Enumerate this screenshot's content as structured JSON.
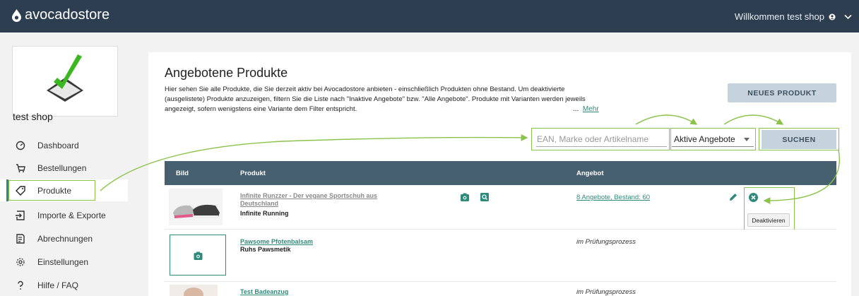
{
  "header": {
    "logo_text": "avocadostore",
    "welcome": "Willkommen test shop"
  },
  "sidebar": {
    "shop_name": "test shop",
    "items": [
      {
        "label": "Dashboard",
        "icon": "dashboard-icon"
      },
      {
        "label": "Bestellungen",
        "icon": "cart-icon"
      },
      {
        "label": "Produkte",
        "icon": "tag-icon",
        "active": true
      },
      {
        "label": "Importe & Exporte",
        "icon": "import-icon"
      },
      {
        "label": "Abrechnungen",
        "icon": "invoice-icon"
      },
      {
        "label": "Einstellungen",
        "icon": "gear-icon"
      },
      {
        "label": "Hilfe / FAQ",
        "icon": "help-icon"
      }
    ]
  },
  "main": {
    "title": "Angebotene Produkte",
    "description": "Hier sehen Sie alle Produkte, die Sie derzeit aktiv bei Avocadostore anbieten - einschließlich Produkten ohne Bestand. Um deaktivierte (ausgelistete) Produkte anzuzeigen, filtern Sie die Liste nach \"Inaktive Angebote\" bzw. \"Alle Angebote\". Produkte mit Varianten werden jeweils angezeigt, sofern wenigstens eine Variante dem Filter entspricht.",
    "more_ellipsis": "...",
    "more_link": "Mehr",
    "new_product_button": "NEUES PRODUKT",
    "search_placeholder": "EAN, Marke oder Artikelname",
    "filter_selected": "Aktive Angebote",
    "search_button": "SUCHEN"
  },
  "table": {
    "columns": [
      "Bild",
      "Produkt",
      "Angebot"
    ],
    "rows": [
      {
        "name": "Infinite Runzzer - Der vegane Sportschuh aus Deutschland",
        "brand": "Infinite Running",
        "offer": "8 Angebote, Bestand: 60"
      },
      {
        "name": "Pawsome Pfotenbalsam",
        "brand": "Ruhs Pawsmetik",
        "status": "im Prüfungsprozess"
      },
      {
        "name": "Test Badeanzug",
        "brand": "",
        "status": "im Prüfungsprozess"
      }
    ]
  },
  "tooltip": "Deaktivieren",
  "colors": {
    "accent": "#2f8a7c",
    "header": "#2c3e50",
    "table_header": "#46606f",
    "highlight": "#8bc34a",
    "button": "#c6d3dc"
  }
}
